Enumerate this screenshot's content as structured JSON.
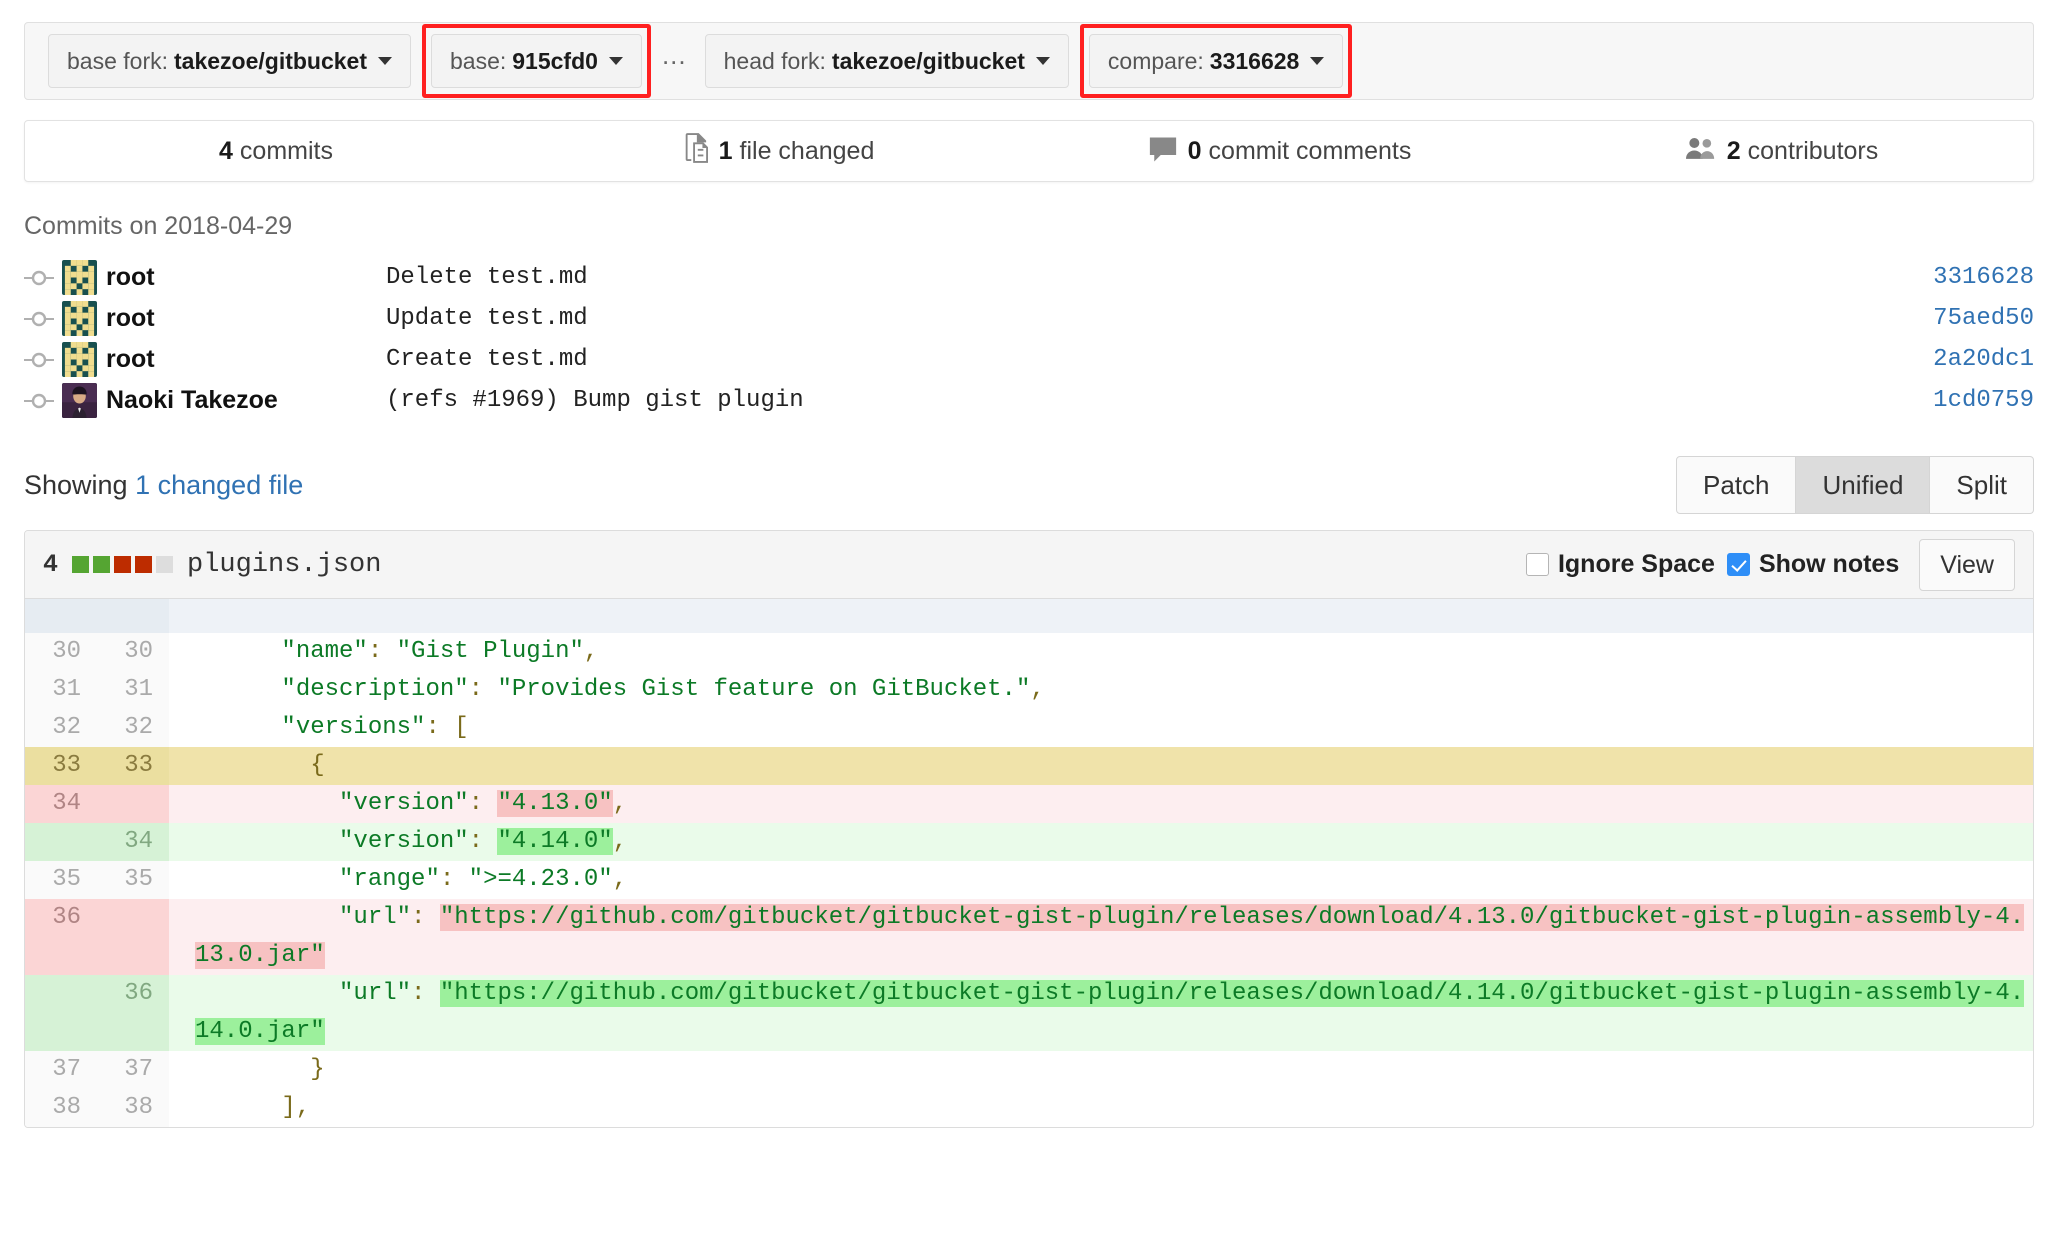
{
  "compare_bar": {
    "base_fork": {
      "label": "base fork:",
      "value": "takezoe/gitbucket",
      "highlighted": false
    },
    "base": {
      "label": "base:",
      "value": "915cfd0",
      "highlighted": true
    },
    "separator": "...",
    "head_fork": {
      "label": "head fork:",
      "value": "takezoe/gitbucket",
      "highlighted": false
    },
    "compare": {
      "label": "compare:",
      "value": "3316628",
      "highlighted": true
    }
  },
  "stats": [
    {
      "icon": "",
      "count": "4",
      "label": "commits"
    },
    {
      "icon": "file-diff-icon",
      "count": "1",
      "label": "file changed"
    },
    {
      "icon": "comment-icon",
      "count": "0",
      "label": "commit comments"
    },
    {
      "icon": "people-icon",
      "count": "2",
      "label": "contributors"
    }
  ],
  "commits": {
    "heading": "Commits on 2018-04-29",
    "rows": [
      {
        "author": "root",
        "avatar": "identicon",
        "message": "Delete test.md",
        "id": "3316628"
      },
      {
        "author": "root",
        "avatar": "identicon",
        "message": "Update test.md",
        "id": "75aed50"
      },
      {
        "author": "root",
        "avatar": "identicon",
        "message": "Create test.md",
        "id": "2a20dc1"
      },
      {
        "author": "Naoki Takezoe",
        "avatar": "photo",
        "message": "(refs #1969) Bump gist plugin",
        "id": "1cd0759"
      }
    ]
  },
  "showing": {
    "prefix": "Showing",
    "link": "1 changed file",
    "view_modes": [
      {
        "label": "Patch",
        "active": false
      },
      {
        "label": "Unified",
        "active": true
      },
      {
        "label": "Split",
        "active": false
      }
    ]
  },
  "diff_file": {
    "change_count": "4",
    "stat_squares": [
      "add",
      "add",
      "del",
      "del",
      "none"
    ],
    "filename": "plugins.json",
    "ignore_space": {
      "label": "Ignore Space",
      "checked": false
    },
    "show_notes": {
      "label": "Show notes",
      "checked": true
    },
    "view_button": "View",
    "lines": [
      {
        "type": "ctx",
        "old": "30",
        "new": "30",
        "indent": "      ",
        "parts": [
          {
            "t": "\"name\"",
            "c": "str"
          },
          {
            "t": ":",
            "c": "punc"
          },
          {
            "t": " "
          },
          {
            "t": "\"Gist Plugin\"",
            "c": "str"
          },
          {
            "t": ",",
            "c": "punc"
          }
        ]
      },
      {
        "type": "ctx",
        "old": "31",
        "new": "31",
        "indent": "      ",
        "parts": [
          {
            "t": "\"description\"",
            "c": "str"
          },
          {
            "t": ":",
            "c": "punc"
          },
          {
            "t": " "
          },
          {
            "t": "\"Provides Gist feature on GitBucket.\"",
            "c": "str"
          },
          {
            "t": ",",
            "c": "punc"
          }
        ]
      },
      {
        "type": "ctx",
        "old": "32",
        "new": "32",
        "indent": "      ",
        "parts": [
          {
            "t": "\"versions\"",
            "c": "str"
          },
          {
            "t": ":",
            "c": "punc"
          },
          {
            "t": " "
          },
          {
            "t": "[",
            "c": "punc"
          }
        ]
      },
      {
        "type": "mark",
        "old": "33",
        "new": "33",
        "indent": "        ",
        "parts": [
          {
            "t": "{",
            "c": "punc"
          }
        ]
      },
      {
        "type": "del",
        "old": "34",
        "new": "",
        "indent": "          ",
        "parts": [
          {
            "t": "\"version\"",
            "c": "str"
          },
          {
            "t": ":",
            "c": "punc"
          },
          {
            "t": " "
          },
          {
            "t": "\"4.13.0\"",
            "c": "str",
            "w": "wdel"
          },
          {
            "t": ",",
            "c": "punc"
          }
        ]
      },
      {
        "type": "add",
        "old": "",
        "new": "34",
        "indent": "          ",
        "parts": [
          {
            "t": "\"version\"",
            "c": "str"
          },
          {
            "t": ":",
            "c": "punc"
          },
          {
            "t": " "
          },
          {
            "t": "\"4.14.0\"",
            "c": "str",
            "w": "wadd"
          },
          {
            "t": ",",
            "c": "punc"
          }
        ]
      },
      {
        "type": "ctx",
        "old": "35",
        "new": "35",
        "indent": "          ",
        "parts": [
          {
            "t": "\"range\"",
            "c": "str"
          },
          {
            "t": ":",
            "c": "punc"
          },
          {
            "t": " "
          },
          {
            "t": "\">=4.23.0\"",
            "c": "str"
          },
          {
            "t": ",",
            "c": "punc"
          }
        ]
      },
      {
        "type": "del",
        "old": "36",
        "new": "",
        "indent": "          ",
        "parts": [
          {
            "t": "\"url\"",
            "c": "str"
          },
          {
            "t": ":",
            "c": "punc"
          },
          {
            "t": " "
          },
          {
            "t": "\"https://github.com/gitbucket/gitbucket-gist-plugin/releases/download/4.13.0/gitbucket-gist-plugin-assembly-4.13.0.jar\"",
            "c": "str",
            "w": "wdel"
          }
        ]
      },
      {
        "type": "add",
        "old": "",
        "new": "36",
        "indent": "          ",
        "parts": [
          {
            "t": "\"url\"",
            "c": "str"
          },
          {
            "t": ":",
            "c": "punc"
          },
          {
            "t": " "
          },
          {
            "t": "\"https://github.com/gitbucket/gitbucket-gist-plugin/releases/download/4.14.0/gitbucket-gist-plugin-assembly-4.14.0.jar\"",
            "c": "str",
            "w": "wadd"
          }
        ]
      },
      {
        "type": "ctx",
        "old": "37",
        "new": "37",
        "indent": "        ",
        "parts": [
          {
            "t": "}",
            "c": "punc"
          }
        ]
      },
      {
        "type": "ctx",
        "old": "38",
        "new": "38",
        "indent": "      ",
        "parts": [
          {
            "t": "]",
            "c": "punc"
          },
          {
            "t": ",",
            "c": "punc"
          }
        ]
      }
    ]
  },
  "colors": {
    "link": "#3072b3",
    "add_square": "#55a532",
    "del_square": "#bd2c00",
    "highlight_box": "#ff2020",
    "checkbox_checked": "#2e8ef7",
    "string": "#0c7a26"
  }
}
